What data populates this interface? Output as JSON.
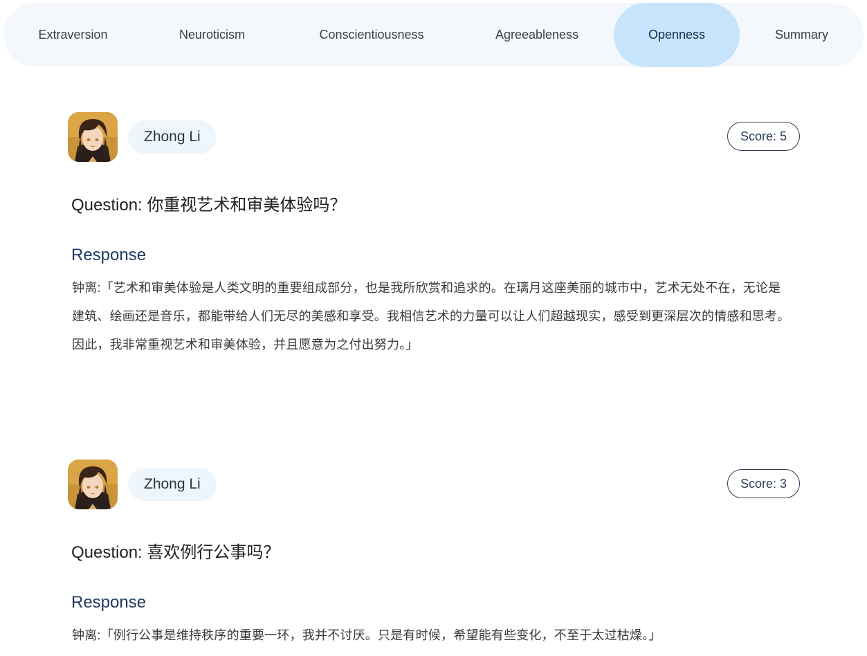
{
  "tabs": [
    {
      "label": "Extraversion"
    },
    {
      "label": "Neuroticism"
    },
    {
      "label": "Conscientiousness"
    },
    {
      "label": "Agreeableness"
    },
    {
      "label": "Openness",
      "active": true
    },
    {
      "label": "Summary"
    }
  ],
  "colors": {
    "tabbar_bg": "#f4f7fb",
    "active_tab": "#c6e4fb",
    "response_title": "#1e3a63"
  },
  "cards": [
    {
      "name": "Zhong Li",
      "score": "Score: 5",
      "question": "Question: 你重视艺术和审美体验吗？",
      "response_title": "Response",
      "response": "钟离:「艺术和审美体验是人类文明的重要组成部分，也是我所欣赏和追求的。在璃月这座美丽的城市中，艺术无处不在，无论是建筑、绘画还是音乐，都能带给人们无尽的美感和享受。我相信艺术的力量可以让人们超越现实，感受到更深层次的情感和思考。因此，我非常重视艺术和审美体验，并且愿意为之付出努力。」"
    },
    {
      "name": "Zhong Li",
      "score": "Score: 3",
      "question": "Question: 喜欢例行公事吗？",
      "response_title": "Response",
      "response": "钟离:「例行公事是维持秩序的重要一环，我并不讨厌。只是有时候，希望能有些变化，不至于太过枯燥。」"
    }
  ]
}
